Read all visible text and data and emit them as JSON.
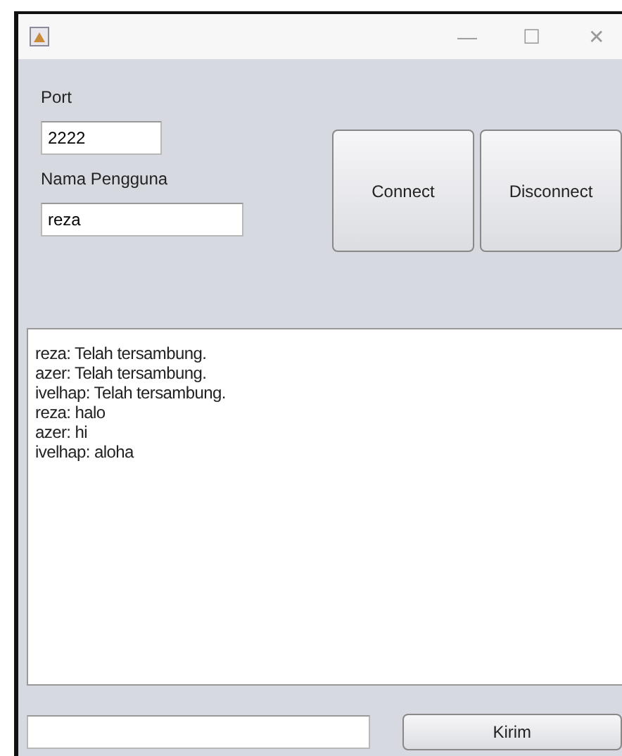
{
  "window": {
    "controls": [
      "—",
      "☐",
      "✕"
    ]
  },
  "port": {
    "label": "Port",
    "value": "2222"
  },
  "username": {
    "label": "Nama Pengguna",
    "value": "reza"
  },
  "buttons": [
    "Connect",
    "Disconnect"
  ],
  "messages": [
    "reza: Telah tersambung.",
    "azer: Telah tersambung.",
    "ivelhap: Telah tersambung.",
    "reza: halo",
    "azer: hi",
    "ivelhap: aloha"
  ],
  "send_button": "Kirim"
}
